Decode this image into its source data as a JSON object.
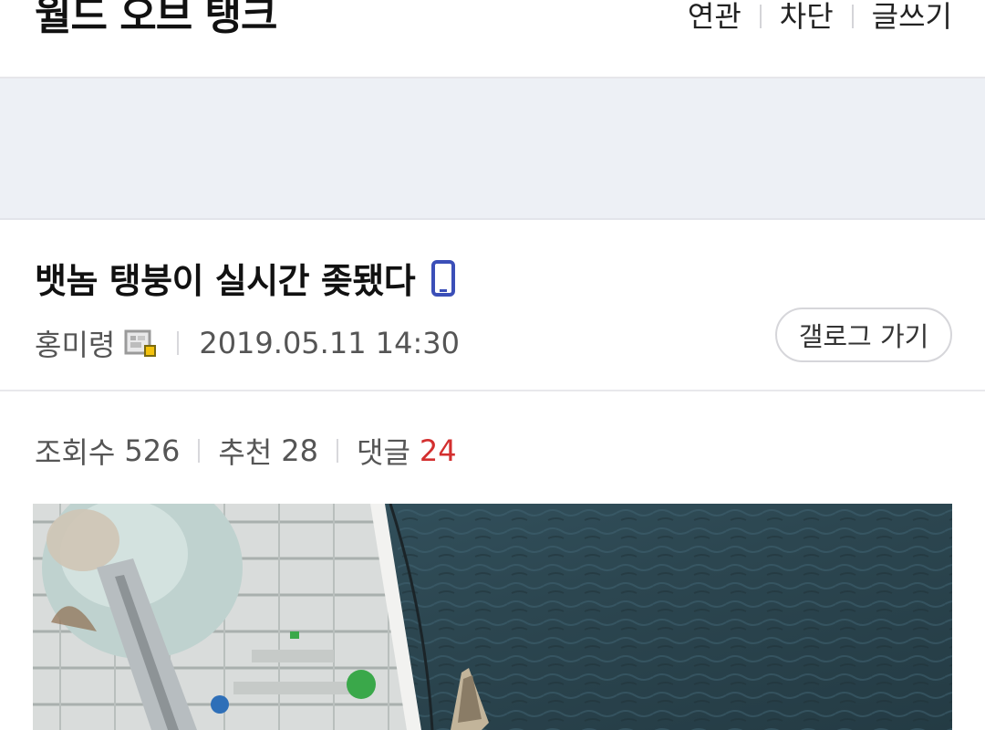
{
  "header": {
    "gallery_title": "월드 오브 탱크",
    "links": [
      "연관",
      "차단",
      "글쓰기"
    ]
  },
  "post": {
    "title": "뱃놈 탱붕이 실시간 좆됐다",
    "author": "홍미령",
    "date": "2019.05.11 14:30",
    "gallery_button": "갤로그 가기"
  },
  "stats": {
    "views_label": "조회수",
    "views": "526",
    "recommend_label": "추천",
    "recommend": "28",
    "comments_label": "댓글",
    "comments": "24"
  },
  "colors": {
    "accent_red": "#d32f2f",
    "icon_blue": "#3b4fb8",
    "sea": "#2d4852"
  },
  "icons": [
    "mobile-phone-icon",
    "fixed-nickname-icon"
  ]
}
